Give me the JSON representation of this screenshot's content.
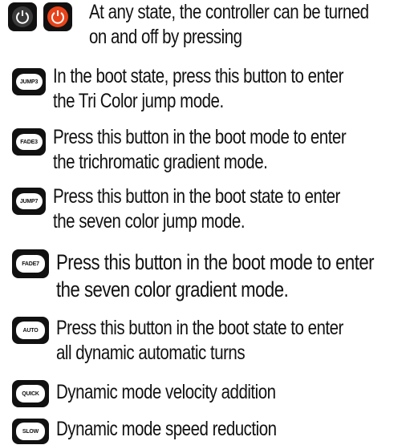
{
  "colors": {
    "key_bg": "#111111",
    "off_bg": "#3a3a3a",
    "on_bg": "#e8431a"
  },
  "rows": [
    {
      "icons": [
        "OFF",
        "ON"
      ],
      "lines": [
        "At any state, the controller can be turned",
        "on and off by pressing"
      ]
    },
    {
      "icons": [
        "JUMP3"
      ],
      "lines": [
        "In the boot state, press this button to enter",
        "the Tri Color jump mode."
      ]
    },
    {
      "icons": [
        "FADE3"
      ],
      "lines": [
        "Press this button in the boot mode to enter",
        "the trichromatic gradient mode."
      ]
    },
    {
      "icons": [
        "JUMP7"
      ],
      "lines": [
        "Press this button in the boot state to enter",
        "the seven color jump mode."
      ]
    },
    {
      "icons": [
        "FADE7"
      ],
      "lines": [
        "Press this button in the boot mode to enter",
        "the seven color gradient mode."
      ]
    },
    {
      "icons": [
        "AUTO"
      ],
      "lines": [
        "Press this button in the boot state to enter",
        "all dynamic automatic turns"
      ]
    },
    {
      "icons": [
        "QUICK"
      ],
      "lines": [
        "Dynamic mode velocity addition"
      ]
    },
    {
      "icons": [
        "SLOW"
      ],
      "lines": [
        "Dynamic mode speed reduction"
      ]
    }
  ]
}
